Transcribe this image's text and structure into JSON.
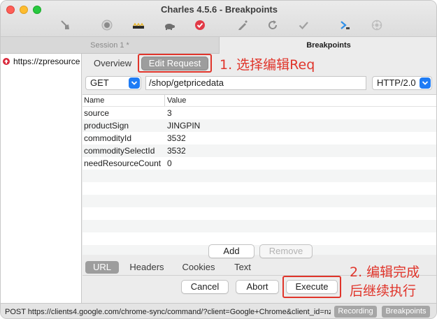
{
  "window": {
    "title": "Charles 4.5.6 - Breakpoints"
  },
  "tabs": {
    "session": "Session 1 *",
    "breakpoints": "Breakpoints"
  },
  "sidebar": {
    "item": "https://zpresource"
  },
  "subtabs": {
    "overview": "Overview",
    "edit_request": "Edit Request"
  },
  "annotation1": "1. 选择编辑Req",
  "annotation2_line1": "2. 编辑完成",
  "annotation2_line2": "后继续执行",
  "request": {
    "method": "GET",
    "path": "/shop/getpricedata",
    "protocol": "HTTP/2.0"
  },
  "table": {
    "headers": [
      "Name",
      "Value"
    ],
    "rows": [
      {
        "name": "source",
        "value": "3"
      },
      {
        "name": "productSign",
        "value": "JINGPIN"
      },
      {
        "name": "commodityId",
        "value": "3532"
      },
      {
        "name": "commoditySelectId",
        "value": "3532"
      },
      {
        "name": "needResourceCount",
        "value": "0"
      }
    ]
  },
  "buttons": {
    "add": "Add",
    "remove": "Remove",
    "cancel": "Cancel",
    "abort": "Abort",
    "execute": "Execute"
  },
  "bottom_tabs": {
    "url": "URL",
    "headers": "Headers",
    "cookies": "Cookies",
    "text": "Text"
  },
  "status": {
    "text": "POST https://clients4.google.com/chrome-sync/command/?client=Google+Chrome&client_id=nz...",
    "recording": "Recording",
    "breakpoints": "Breakpoints"
  },
  "colors": {
    "accent": "#1f7cf5",
    "annotation": "#e0352b"
  },
  "icons": [
    "broom-icon",
    "record-icon",
    "throttle-icon",
    "turtle-icon",
    "breakpoint-icon",
    "pen-icon",
    "refresh-icon",
    "check-icon",
    "tools-icon",
    "settings-icon"
  ]
}
